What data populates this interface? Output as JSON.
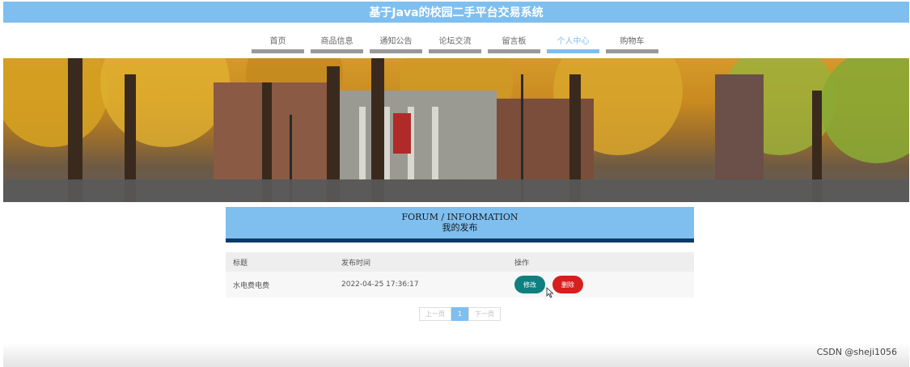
{
  "header": {
    "title": "基于Java的校园二手平台交易系统"
  },
  "nav": {
    "items": [
      {
        "label": "首页"
      },
      {
        "label": "商品信息"
      },
      {
        "label": "通知公告"
      },
      {
        "label": "论坛交流"
      },
      {
        "label": "留言板"
      },
      {
        "label": "个人中心",
        "active": true
      },
      {
        "label": "购物车"
      }
    ]
  },
  "section": {
    "title_en": "FORUM / INFORMATION",
    "title_zh": "我的发布"
  },
  "table": {
    "columns": [
      "标题",
      "发布时间",
      "操作"
    ],
    "rows": [
      {
        "title": "水电费电费",
        "time": "2022-04-25 17:36:17",
        "edit_label": "修改",
        "delete_label": "删除"
      }
    ]
  },
  "pagination": {
    "prev": "上一页",
    "current": "1",
    "next": "下一页"
  },
  "watermark": "CSDN @sheji1056",
  "colors": {
    "primary": "#7ebff0",
    "dark_bar": "#0d3a66",
    "edit": "#0f8080",
    "delete": "#d61f1f"
  }
}
